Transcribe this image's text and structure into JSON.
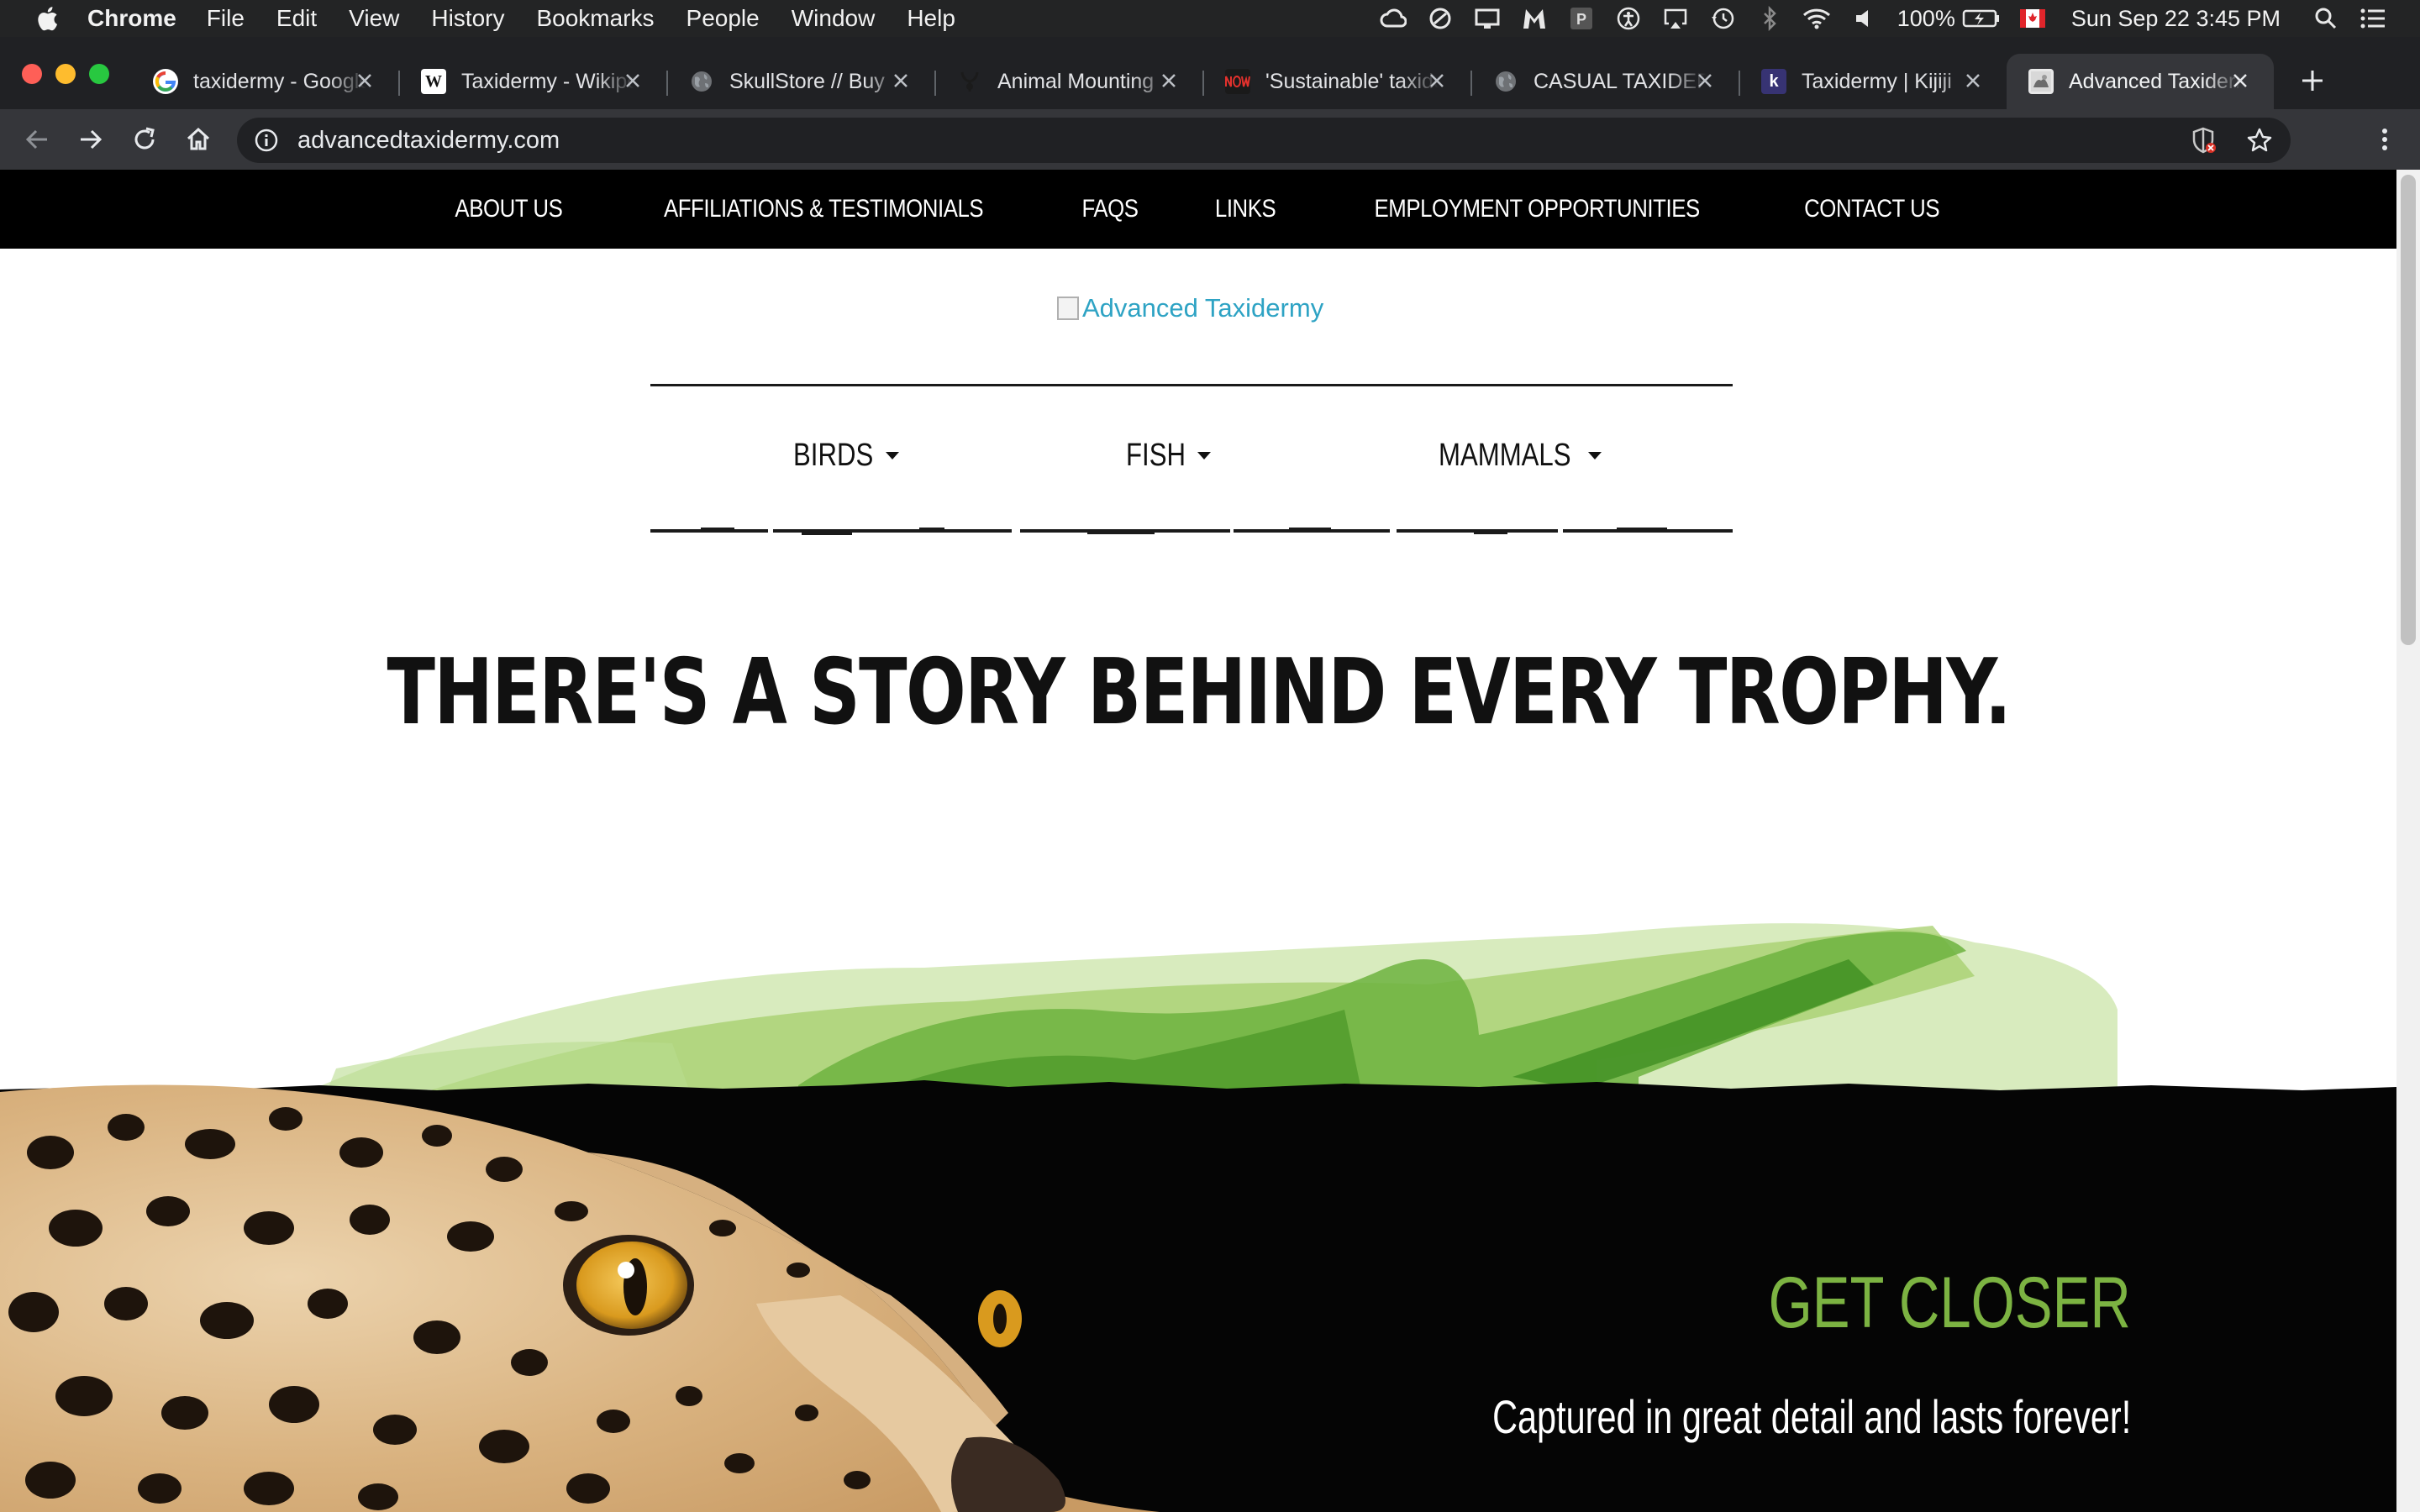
{
  "menubar": {
    "app_name": "Chrome",
    "items": [
      "File",
      "Edit",
      "View",
      "History",
      "Bookmarks",
      "People",
      "Window",
      "Help"
    ],
    "battery": "100%",
    "datetime": "Sun Sep 22  3:45 PM"
  },
  "tabs": [
    {
      "title": "taxidermy - Google Search",
      "favicon": "google-icon"
    },
    {
      "title": "Taxidermy - Wikipedia",
      "favicon": "wikipedia-icon"
    },
    {
      "title": "SkullStore // Buy",
      "favicon": "globe-icon"
    },
    {
      "title": "Animal Mounting",
      "favicon": "antler-icon"
    },
    {
      "title": "'Sustainable' taxidermy",
      "favicon": "now-icon"
    },
    {
      "title": "CASUAL TAXIDERMY",
      "favicon": "globe-icon"
    },
    {
      "title": "Taxidermy | Kijiji",
      "favicon": "kijiji-icon"
    },
    {
      "title": "Advanced Taxidermy",
      "favicon": "site-icon"
    }
  ],
  "address_bar": {
    "url": "advancedtaxidermy.com"
  },
  "site": {
    "top_nav": [
      "ABOUT US",
      "AFFILIATIONS & TESTIMONIALS",
      "FAQS",
      "LINKS",
      "EMPLOYMENT OPPORTUNITIES",
      "CONTACT US"
    ],
    "logo_alt": "Advanced Taxidermy",
    "categories": [
      {
        "label": "BIRDS"
      },
      {
        "label": "FISH"
      },
      {
        "label": "MAMMALS"
      }
    ],
    "headline": "THERE'S A STORY BEHIND EVERY TROPHY.",
    "hero": {
      "heading": "GET CLOSER",
      "tagline": "Captured in great detail and lasts forever!"
    }
  },
  "colors": {
    "accent_green": "#7cb342",
    "link_blue": "#2ea3c4",
    "nav_black": "#000000"
  }
}
